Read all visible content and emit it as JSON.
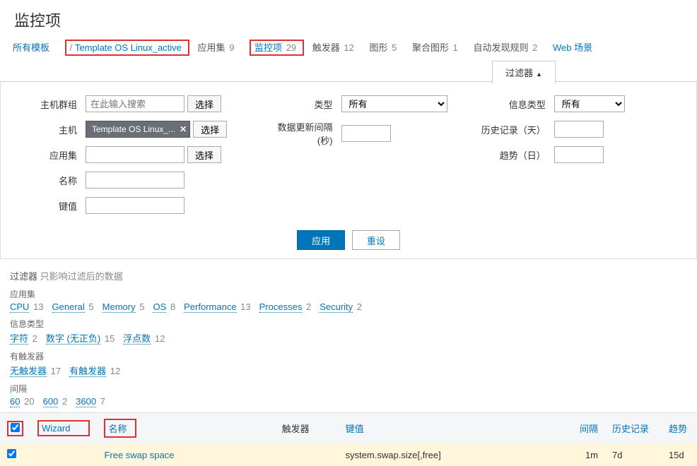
{
  "page_title": "监控项",
  "nav": {
    "all_templates": "所有模板",
    "template_name": "Template OS Linux_active",
    "app_sets": {
      "label": "应用集",
      "count": "9"
    },
    "items": {
      "label": "监控项",
      "count": "29"
    },
    "triggers": {
      "label": "触发器",
      "count": "12"
    },
    "graphs": {
      "label": "图形",
      "count": "5"
    },
    "screens": {
      "label": "聚合图形",
      "count": "1"
    },
    "discovery": {
      "label": "自动发现规则",
      "count": "2"
    },
    "web": {
      "label": "Web 场景"
    }
  },
  "filter_tab": "过滤器",
  "filter": {
    "hostgroup_label": "主机群组",
    "hostgroup_placeholder": "在此输入搜索",
    "select_btn": "选择",
    "host_label": "主机",
    "host_chip": "Template OS Linux_...",
    "appset_label": "应用集",
    "name_label": "名称",
    "key_label": "键值",
    "type_label": "类型",
    "type_value": "所有",
    "update_interval_label": "数据更新间隔(秒)",
    "info_type_label": "信息类型",
    "info_type_value": "所有",
    "history_label": "历史记录（天）",
    "trends_label": "趋势（日）",
    "apply_btn": "应用",
    "reset_btn": "重设"
  },
  "subfilter": {
    "title": "过滤器",
    "hint": "只影响过滤后的数据",
    "appset_head": "应用集",
    "appset_items": [
      {
        "label": "CPU",
        "count": "13"
      },
      {
        "label": "General",
        "count": "5"
      },
      {
        "label": "Memory",
        "count": "5"
      },
      {
        "label": "OS",
        "count": "8"
      },
      {
        "label": "Performance",
        "count": "13"
      },
      {
        "label": "Processes",
        "count": "2"
      },
      {
        "label": "Security",
        "count": "2"
      }
    ],
    "info_head": "信息类型",
    "info_items": [
      {
        "label": "字符",
        "count": "2"
      },
      {
        "label": "数字 (无正负)",
        "count": "15"
      },
      {
        "label": "浮点数",
        "count": "12"
      }
    ],
    "trigger_head": "有触发器",
    "trigger_items": [
      {
        "label": "无触发器",
        "count": "17"
      },
      {
        "label": "有触发器",
        "count": "12"
      }
    ],
    "interval_head": "间隔",
    "interval_items": [
      {
        "label": "60",
        "count": "20"
      },
      {
        "label": "600",
        "count": "2"
      },
      {
        "label": "3600",
        "count": "7"
      }
    ]
  },
  "table": {
    "headers": {
      "wizard": "Wizard",
      "name": "名称",
      "triggers": "触发器",
      "key": "键值",
      "interval": "间隔",
      "history": "历史记录",
      "trends": "趋势"
    },
    "row": {
      "name": "Free swap space",
      "key": "system.swap.size[,free]",
      "interval": "1m",
      "history": "7d",
      "trends": "15d"
    }
  }
}
